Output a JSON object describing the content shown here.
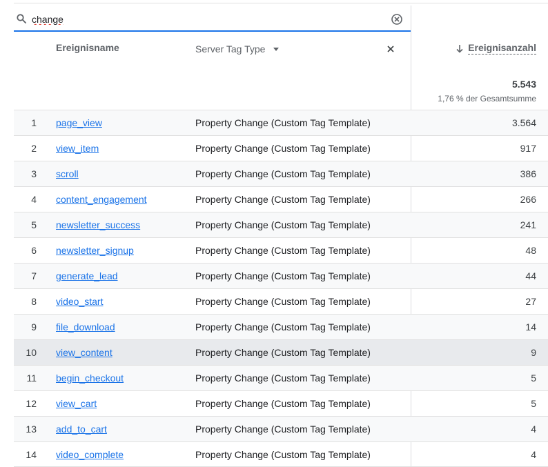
{
  "search": {
    "value": "change",
    "placeholder": ""
  },
  "table": {
    "headers": {
      "event_name": "Ereignisname",
      "server_tag_type": "Server Tag Type",
      "event_count": "Ereignisanzahl"
    },
    "total": {
      "value": "5.543",
      "percent": "1,76 % der Gesamtsumme"
    },
    "rows": [
      {
        "num": "1",
        "name": "page_view",
        "type": "Property Change (Custom Tag Template)",
        "count": "3.564"
      },
      {
        "num": "2",
        "name": "view_item",
        "type": "Property Change (Custom Tag Template)",
        "count": "917"
      },
      {
        "num": "3",
        "name": "scroll",
        "type": "Property Change (Custom Tag Template)",
        "count": "386"
      },
      {
        "num": "4",
        "name": "content_engagement",
        "type": "Property Change (Custom Tag Template)",
        "count": "266"
      },
      {
        "num": "5",
        "name": "newsletter_success",
        "type": "Property Change (Custom Tag Template)",
        "count": "241"
      },
      {
        "num": "6",
        "name": "newsletter_signup",
        "type": "Property Change (Custom Tag Template)",
        "count": "48"
      },
      {
        "num": "7",
        "name": "generate_lead",
        "type": "Property Change (Custom Tag Template)",
        "count": "44"
      },
      {
        "num": "8",
        "name": "video_start",
        "type": "Property Change (Custom Tag Template)",
        "count": "27"
      },
      {
        "num": "9",
        "name": "file_download",
        "type": "Property Change (Custom Tag Template)",
        "count": "14"
      },
      {
        "num": "10",
        "name": "view_content",
        "type": "Property Change (Custom Tag Template)",
        "count": "9"
      },
      {
        "num": "11",
        "name": "begin_checkout",
        "type": "Property Change (Custom Tag Template)",
        "count": "5"
      },
      {
        "num": "12",
        "name": "view_cart",
        "type": "Property Change (Custom Tag Template)",
        "count": "5"
      },
      {
        "num": "13",
        "name": "add_to_cart",
        "type": "Property Change (Custom Tag Template)",
        "count": "4"
      },
      {
        "num": "14",
        "name": "video_complete",
        "type": "Property Change (Custom Tag Template)",
        "count": "4"
      }
    ]
  },
  "icons": {
    "search": "search-icon",
    "clear": "clear-circle-icon",
    "dropdown": "caret-down-icon",
    "remove_dimension": "close-icon",
    "sort": "down-arrow-icon"
  },
  "colors": {
    "accent": "#1a73e8",
    "link": "#1a73e8",
    "highlight_row": "#e8eaed",
    "alt_row": "#f8f9fa"
  }
}
